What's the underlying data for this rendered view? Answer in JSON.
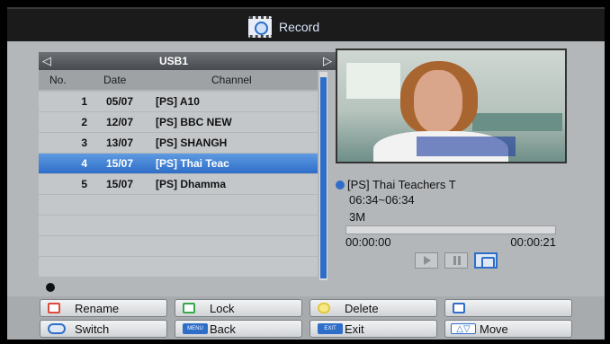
{
  "header": {
    "title": "Record",
    "icon": "record-icon"
  },
  "list": {
    "source": "USB1",
    "nav_left": "◁",
    "nav_right": "▷",
    "columns": {
      "no": "No.",
      "date": "Date",
      "channel": "Channel"
    },
    "rows": [
      {
        "no": "1",
        "date": "05/07",
        "channel": "[PS] A10"
      },
      {
        "no": "2",
        "date": "12/07",
        "channel": "[PS] BBC NEW"
      },
      {
        "no": "3",
        "date": "13/07",
        "channel": "[PS] SHANGH"
      },
      {
        "no": "4",
        "date": "15/07",
        "channel": "[PS] Thai Teac",
        "selected": true
      },
      {
        "no": "5",
        "date": "15/07",
        "channel": "[PS] Dhamma"
      }
    ]
  },
  "details": {
    "channel": "[PS] Thai Teachers T",
    "time_range": "06:34~06:34",
    "size": "3M",
    "progress": 0.0,
    "current_time": "00:00:00",
    "total_time": "00:00:21"
  },
  "buttons": {
    "rename": "Rename",
    "lock": "Lock",
    "delete": "Delete",
    "blue": "",
    "switch": "Switch",
    "back": "Back",
    "exit": "Exit",
    "move": "Move",
    "menu_key": "MENU",
    "exit_key": "EXIT",
    "move_key": "△▽"
  },
  "colors": {
    "selected": "#2f6ec8",
    "red": "#e04a3a",
    "green": "#35a84a",
    "yellow": "#e3c93a",
    "blue": "#2f6ec8"
  }
}
